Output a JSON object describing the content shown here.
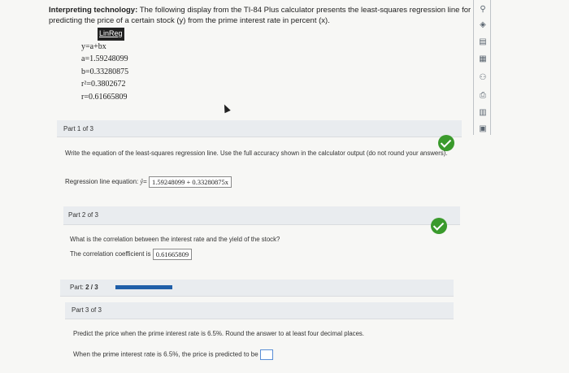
{
  "intro": {
    "bold": "Interpreting technology:",
    "text": " The following display from the TI-84 Plus calculator presents the least-squares regression line for predicting the price of a certain stock (y) from the prime interest rate in percent (x)."
  },
  "calculator": {
    "header": "LinReg",
    "lines": [
      "y=a+bx",
      "a=1.59248099",
      "b=0.33280875",
      "r²=0.3802672",
      "r=0.61665809"
    ]
  },
  "part1": {
    "header": "Part 1 of 3",
    "prompt": "Write the equation of the least-squares regression line. Use the full accuracy shown in the calculator output (do not round your answers).",
    "answer_label": "Regression line equation: ",
    "yhat": "ŷ",
    "equals": "=",
    "answer_value": "1.59248099 + 0.33280875x"
  },
  "part2": {
    "header": "Part 2 of 3",
    "prompt": "What is the correlation between the interest rate and the yield of the stock?",
    "answer_label": "The correlation coefficient is ",
    "answer_value": "0.61665809"
  },
  "progress": {
    "label_prefix": "Part: ",
    "label_value": "2 / 3",
    "fraction": 0.667
  },
  "part3": {
    "header": "Part 3 of 3",
    "prompt": "Predict the price when the prime interest rate is 6.5%. Round the answer to at least four decimal places.",
    "answer_label": "When the prime interest rate is 6.5%, the price is predicted to be ",
    "answer_value": ""
  },
  "sidebar": {
    "icons": [
      "link-icon",
      "compass-icon",
      "note-icon",
      "calculator-icon",
      "people-icon",
      "printer-icon",
      "chart-icon",
      "book-icon"
    ]
  },
  "colors": {
    "check": "#3a9a2c",
    "progress": "#1f5ea8",
    "panel": "#e9ecef"
  }
}
